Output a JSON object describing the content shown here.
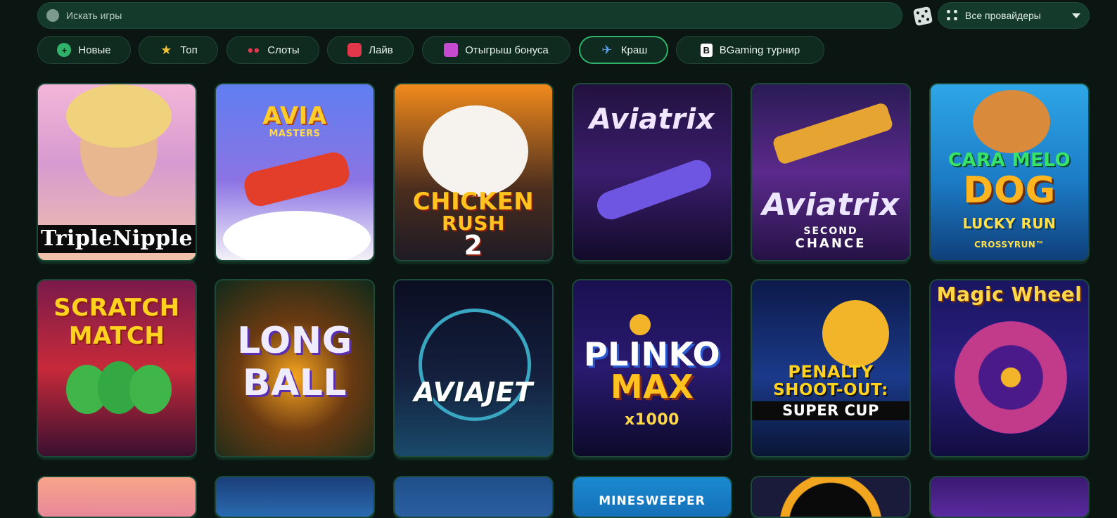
{
  "search": {
    "placeholder": "Искать игры"
  },
  "provider_select": {
    "label": "Все провайдеры"
  },
  "categories": [
    {
      "label": "Новые",
      "icon": "plus-icon"
    },
    {
      "label": "Топ",
      "icon": "star-icon"
    },
    {
      "label": "Слоты",
      "icon": "cherry-icon"
    },
    {
      "label": "Лайв",
      "icon": "chip-icon"
    },
    {
      "label": "Отыгрыш бонуса",
      "icon": "gift-icon"
    },
    {
      "label": "Краш",
      "icon": "plane-icon",
      "active": true
    },
    {
      "label": "BGaming турнир",
      "icon": "bgaming-logo-icon"
    }
  ],
  "games": [
    {
      "title": "TripleNipple"
    },
    {
      "title": "AVIA",
      "subtitle": "MASTERS"
    },
    {
      "title": "CHICKEN",
      "subtitle": "RUSH",
      "extra": "2"
    },
    {
      "title": "Aviatrix"
    },
    {
      "title": "Aviatrix",
      "subtitle": "SECOND",
      "extra": "CHANCE"
    },
    {
      "title": "CARA MELO",
      "subtitle": "DOG",
      "extra": "LUCKY RUN",
      "extra2": "CROSSYRUN™"
    },
    {
      "title": "SCRATCH",
      "subtitle": "MATCH"
    },
    {
      "title": "LONG",
      "subtitle": "BALL"
    },
    {
      "title": "AVIAJET"
    },
    {
      "title": "PLINKO",
      "subtitle": "MAX",
      "extra": "x1000"
    },
    {
      "title": "PENALTY",
      "subtitle": "SHOOT-OUT:",
      "extra": "SUPER CUP"
    },
    {
      "title": "Magic Wheel"
    },
    {
      "title": ""
    },
    {
      "title": ""
    },
    {
      "title": ""
    },
    {
      "title": "MINESWEEPER"
    },
    {
      "title": ""
    },
    {
      "title": ""
    }
  ],
  "colors": {
    "accent": "#2fb36a",
    "bg": "#0b1512",
    "panel": "#143a2c"
  }
}
